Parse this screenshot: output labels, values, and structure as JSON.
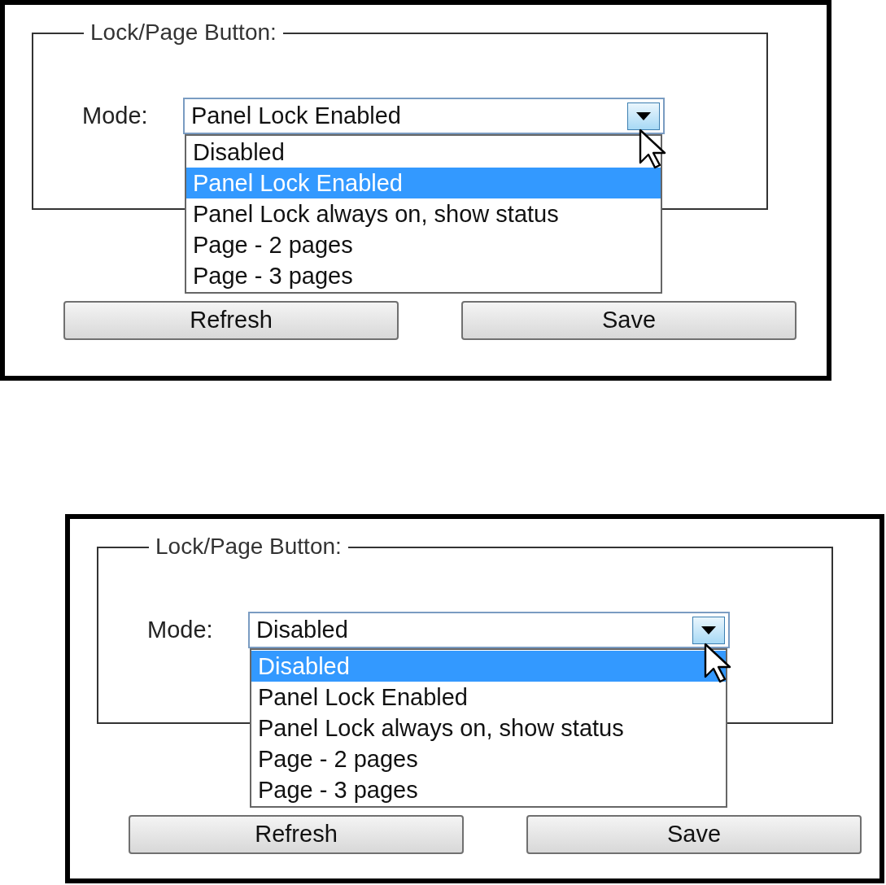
{
  "panels": [
    {
      "group_title": "Lock/Page Button:",
      "mode_label": "Mode:",
      "combo_value": "Panel Lock Enabled",
      "options": [
        {
          "label": "Disabled",
          "selected": false
        },
        {
          "label": "Panel Lock Enabled",
          "selected": true
        },
        {
          "label": "Panel Lock always on, show status",
          "selected": false
        },
        {
          "label": "Page - 2 pages",
          "selected": false
        },
        {
          "label": "Page - 3 pages",
          "selected": false
        }
      ],
      "buttons": [
        "Refresh",
        "Save"
      ]
    },
    {
      "group_title": "Lock/Page Button:",
      "mode_label": "Mode:",
      "combo_value": "Disabled",
      "options": [
        {
          "label": "Disabled",
          "selected": true
        },
        {
          "label": "Panel Lock Enabled",
          "selected": false
        },
        {
          "label": "Panel Lock always on, show status",
          "selected": false
        },
        {
          "label": "Page - 2 pages",
          "selected": false
        },
        {
          "label": "Page - 3 pages",
          "selected": false
        }
      ],
      "buttons": [
        "Refresh",
        "Save"
      ]
    }
  ]
}
